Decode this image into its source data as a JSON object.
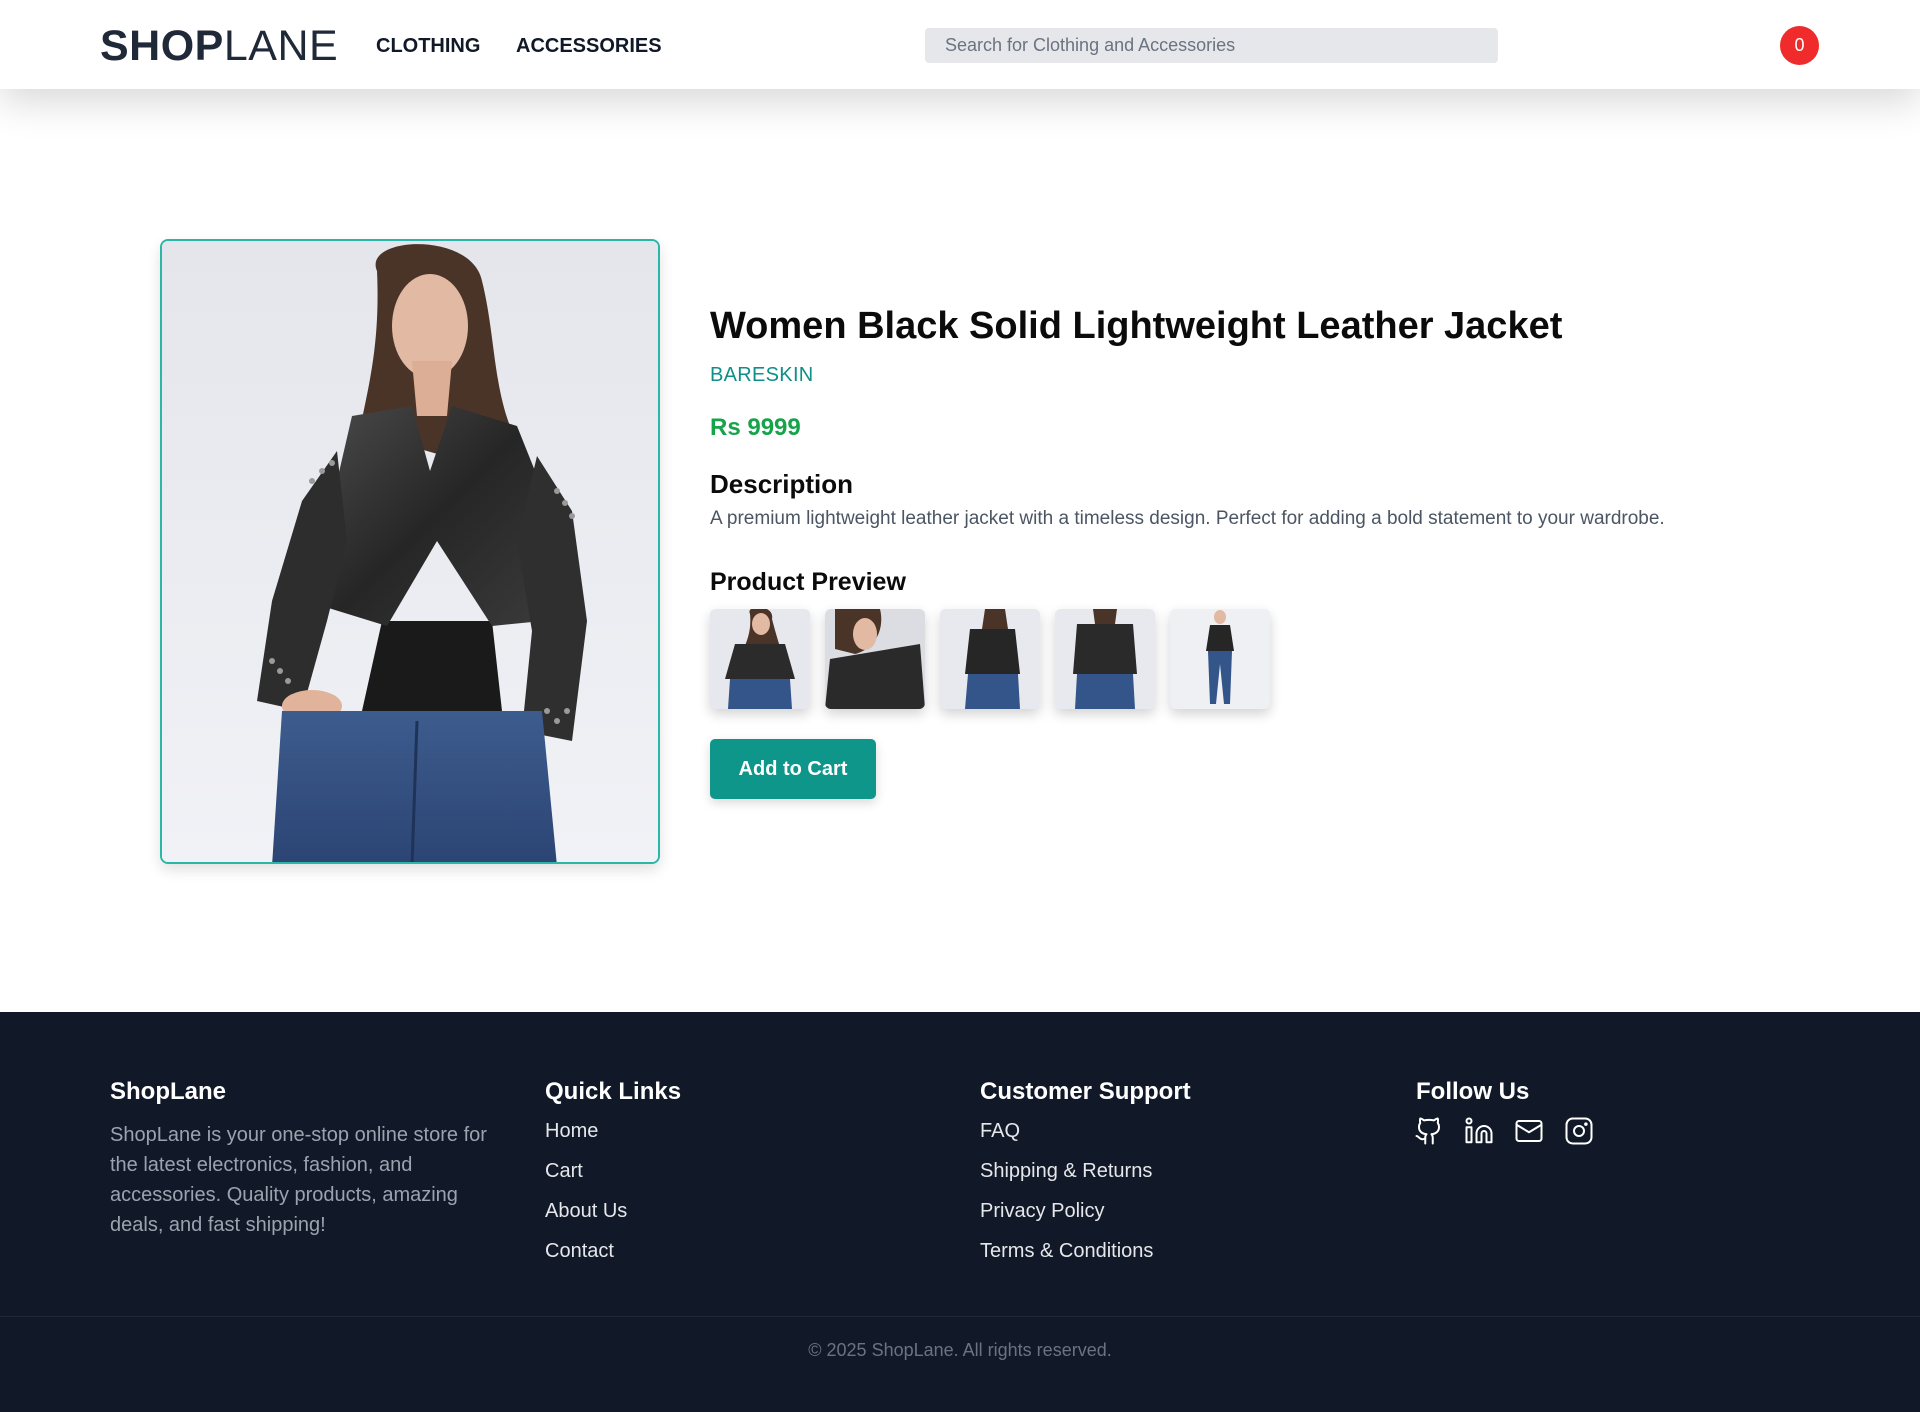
{
  "header": {
    "logo_bold": "SHOP",
    "logo_light": "LANE",
    "nav": [
      {
        "label": "CLOTHING"
      },
      {
        "label": "ACCESSORIES"
      }
    ],
    "search_placeholder": "Search for Clothing and Accessories",
    "cart_count": "0"
  },
  "product": {
    "title": "Women Black Solid Lightweight Leather Jacket",
    "brand": "BARESKIN",
    "price": "Rs 9999",
    "description_heading": "Description",
    "description": "A premium lightweight leather jacket with a timeless design. Perfect for adding a bold statement to your wardrobe.",
    "preview_heading": "Product Preview",
    "add_to_cart_label": "Add to Cart"
  },
  "footer": {
    "brand_heading": "ShopLane",
    "about": "ShopLane is your one-stop online store for the latest electronics, fashion, and accessories. Quality products, amazing deals, and fast shipping!",
    "quick_links_heading": "Quick Links",
    "quick_links": [
      "Home",
      "Cart",
      "About Us",
      "Contact"
    ],
    "support_heading": "Customer Support",
    "support_links": [
      "FAQ",
      "Shipping & Returns",
      "Privacy Policy",
      "Terms & Conditions"
    ],
    "follow_heading": "Follow Us",
    "socials": [
      "github-icon",
      "linkedin-icon",
      "mail-icon",
      "instagram-icon"
    ],
    "copyright": "© 2025 ShopLane. All rights reserved."
  },
  "colors": {
    "accent": "#0f968b",
    "price": "#16a34a",
    "badge": "#ef2b2b",
    "footer_bg": "#111827"
  }
}
